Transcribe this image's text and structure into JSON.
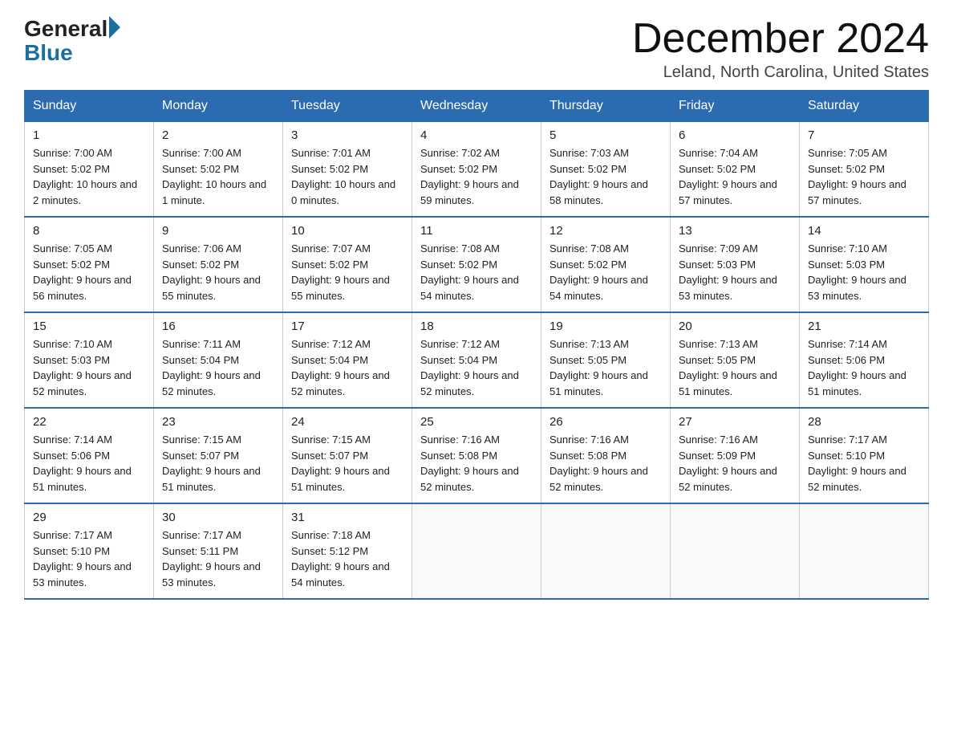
{
  "header": {
    "logo_general": "General",
    "logo_blue": "Blue",
    "month_title": "December 2024",
    "location": "Leland, North Carolina, United States"
  },
  "days_of_week": [
    "Sunday",
    "Monday",
    "Tuesday",
    "Wednesday",
    "Thursday",
    "Friday",
    "Saturday"
  ],
  "weeks": [
    [
      {
        "day": "1",
        "sunrise": "7:00 AM",
        "sunset": "5:02 PM",
        "daylight": "10 hours and 2 minutes."
      },
      {
        "day": "2",
        "sunrise": "7:00 AM",
        "sunset": "5:02 PM",
        "daylight": "10 hours and 1 minute."
      },
      {
        "day": "3",
        "sunrise": "7:01 AM",
        "sunset": "5:02 PM",
        "daylight": "10 hours and 0 minutes."
      },
      {
        "day": "4",
        "sunrise": "7:02 AM",
        "sunset": "5:02 PM",
        "daylight": "9 hours and 59 minutes."
      },
      {
        "day": "5",
        "sunrise": "7:03 AM",
        "sunset": "5:02 PM",
        "daylight": "9 hours and 58 minutes."
      },
      {
        "day": "6",
        "sunrise": "7:04 AM",
        "sunset": "5:02 PM",
        "daylight": "9 hours and 57 minutes."
      },
      {
        "day": "7",
        "sunrise": "7:05 AM",
        "sunset": "5:02 PM",
        "daylight": "9 hours and 57 minutes."
      }
    ],
    [
      {
        "day": "8",
        "sunrise": "7:05 AM",
        "sunset": "5:02 PM",
        "daylight": "9 hours and 56 minutes."
      },
      {
        "day": "9",
        "sunrise": "7:06 AM",
        "sunset": "5:02 PM",
        "daylight": "9 hours and 55 minutes."
      },
      {
        "day": "10",
        "sunrise": "7:07 AM",
        "sunset": "5:02 PM",
        "daylight": "9 hours and 55 minutes."
      },
      {
        "day": "11",
        "sunrise": "7:08 AM",
        "sunset": "5:02 PM",
        "daylight": "9 hours and 54 minutes."
      },
      {
        "day": "12",
        "sunrise": "7:08 AM",
        "sunset": "5:02 PM",
        "daylight": "9 hours and 54 minutes."
      },
      {
        "day": "13",
        "sunrise": "7:09 AM",
        "sunset": "5:03 PM",
        "daylight": "9 hours and 53 minutes."
      },
      {
        "day": "14",
        "sunrise": "7:10 AM",
        "sunset": "5:03 PM",
        "daylight": "9 hours and 53 minutes."
      }
    ],
    [
      {
        "day": "15",
        "sunrise": "7:10 AM",
        "sunset": "5:03 PM",
        "daylight": "9 hours and 52 minutes."
      },
      {
        "day": "16",
        "sunrise": "7:11 AM",
        "sunset": "5:04 PM",
        "daylight": "9 hours and 52 minutes."
      },
      {
        "day": "17",
        "sunrise": "7:12 AM",
        "sunset": "5:04 PM",
        "daylight": "9 hours and 52 minutes."
      },
      {
        "day": "18",
        "sunrise": "7:12 AM",
        "sunset": "5:04 PM",
        "daylight": "9 hours and 52 minutes."
      },
      {
        "day": "19",
        "sunrise": "7:13 AM",
        "sunset": "5:05 PM",
        "daylight": "9 hours and 51 minutes."
      },
      {
        "day": "20",
        "sunrise": "7:13 AM",
        "sunset": "5:05 PM",
        "daylight": "9 hours and 51 minutes."
      },
      {
        "day": "21",
        "sunrise": "7:14 AM",
        "sunset": "5:06 PM",
        "daylight": "9 hours and 51 minutes."
      }
    ],
    [
      {
        "day": "22",
        "sunrise": "7:14 AM",
        "sunset": "5:06 PM",
        "daylight": "9 hours and 51 minutes."
      },
      {
        "day": "23",
        "sunrise": "7:15 AM",
        "sunset": "5:07 PM",
        "daylight": "9 hours and 51 minutes."
      },
      {
        "day": "24",
        "sunrise": "7:15 AM",
        "sunset": "5:07 PM",
        "daylight": "9 hours and 51 minutes."
      },
      {
        "day": "25",
        "sunrise": "7:16 AM",
        "sunset": "5:08 PM",
        "daylight": "9 hours and 52 minutes."
      },
      {
        "day": "26",
        "sunrise": "7:16 AM",
        "sunset": "5:08 PM",
        "daylight": "9 hours and 52 minutes."
      },
      {
        "day": "27",
        "sunrise": "7:16 AM",
        "sunset": "5:09 PM",
        "daylight": "9 hours and 52 minutes."
      },
      {
        "day": "28",
        "sunrise": "7:17 AM",
        "sunset": "5:10 PM",
        "daylight": "9 hours and 52 minutes."
      }
    ],
    [
      {
        "day": "29",
        "sunrise": "7:17 AM",
        "sunset": "5:10 PM",
        "daylight": "9 hours and 53 minutes."
      },
      {
        "day": "30",
        "sunrise": "7:17 AM",
        "sunset": "5:11 PM",
        "daylight": "9 hours and 53 minutes."
      },
      {
        "day": "31",
        "sunrise": "7:18 AM",
        "sunset": "5:12 PM",
        "daylight": "9 hours and 54 minutes."
      },
      null,
      null,
      null,
      null
    ]
  ]
}
